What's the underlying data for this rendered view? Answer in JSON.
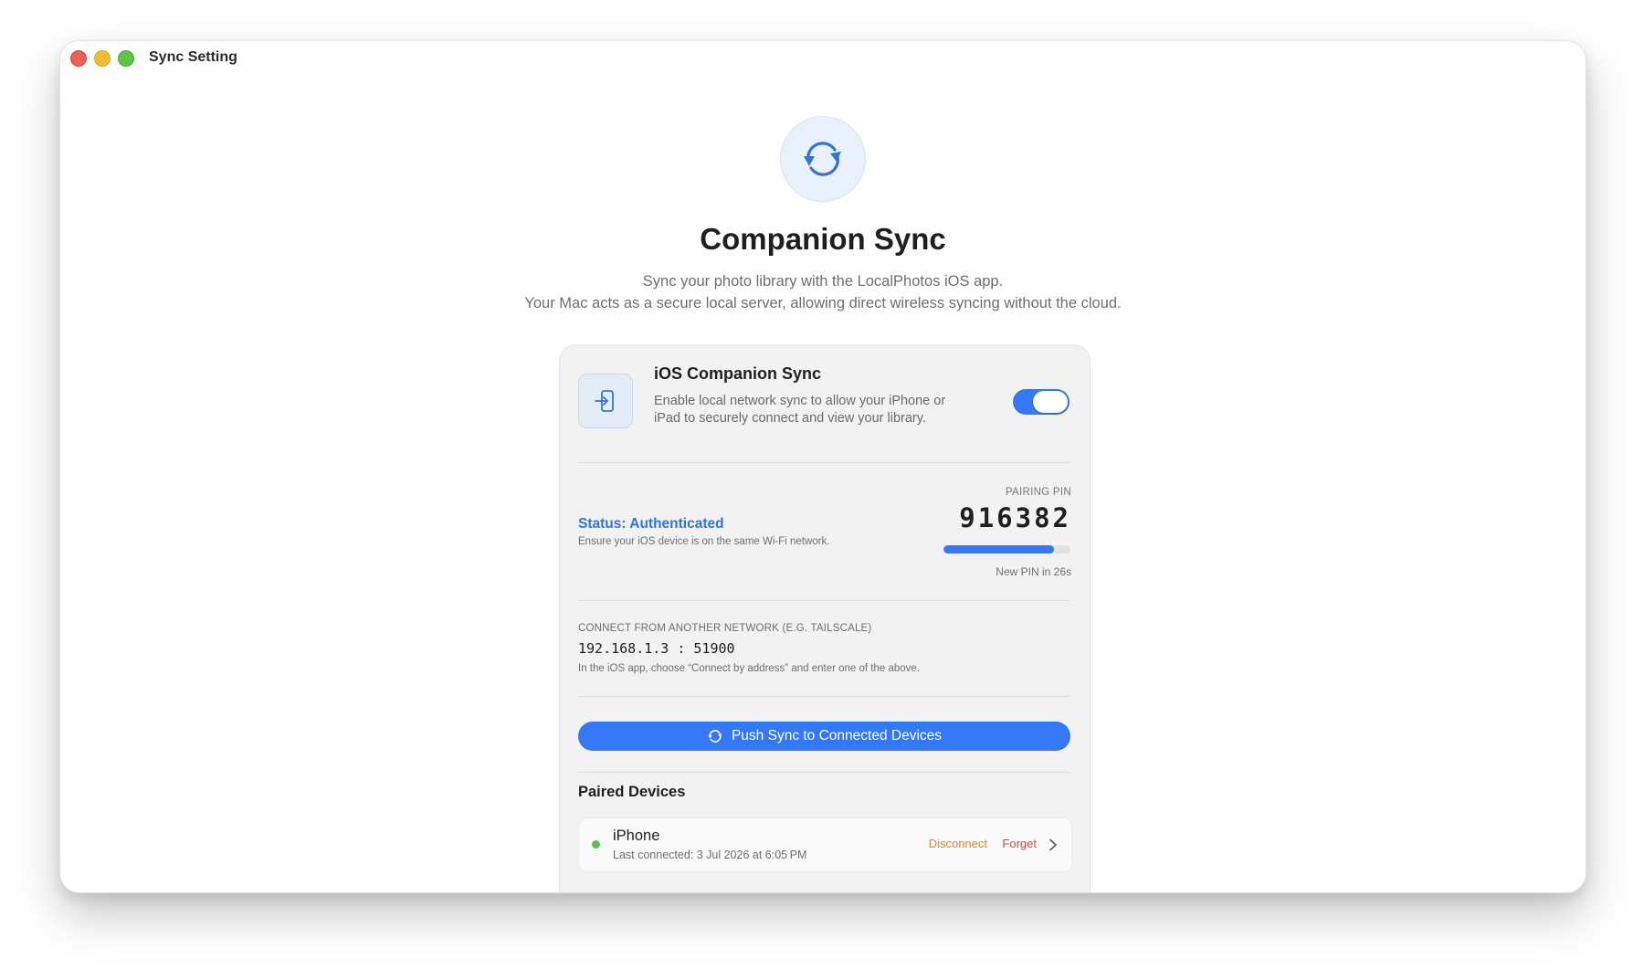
{
  "window": {
    "title": "Sync Setting"
  },
  "hero": {
    "icon": "sync-arrows-icon",
    "title": "Companion Sync",
    "subtitle_line1": "Sync your photo library with the LocalPhotos iOS app.",
    "subtitle_line2": "Your Mac acts as a secure local server, allowing direct wireless syncing without the cloud."
  },
  "sync_section": {
    "icon": "enter-device-icon",
    "title": "iOS Companion Sync",
    "description": "Enable local network sync to allow your iPhone or iPad to securely connect and view your library.",
    "enabled": true
  },
  "status": {
    "label": "Status: Authenticated",
    "hint": "Ensure your iOS device is on the same Wi-Fi network."
  },
  "pairing": {
    "label": "PAIRING PIN",
    "pin": "916382",
    "progress": 0.87,
    "timer_text": "New PIN in 26s"
  },
  "network": {
    "label": "CONNECT FROM ANOTHER NETWORK (E.G. TAILSCALE)",
    "address": "192.168.1.3 : 51900",
    "hint": "In the iOS app, choose “Connect by address” and enter one of the above."
  },
  "push_button": {
    "label": "Push Sync to Connected Devices",
    "icon": "sync-arrows-icon"
  },
  "paired_devices": {
    "title": "Paired Devices",
    "devices": [
      {
        "name": "iPhone",
        "last_connected": "Last connected: 3 Jul 2026 at 6:05 PM",
        "status_color": "#5cbf5a",
        "disconnect_label": "Disconnect",
        "forget_label": "Forget"
      }
    ]
  },
  "colors": {
    "accent": "#3478f6",
    "status_text": "#3574d4",
    "disconnect": "#e3872a",
    "forget": "#d9453d"
  }
}
